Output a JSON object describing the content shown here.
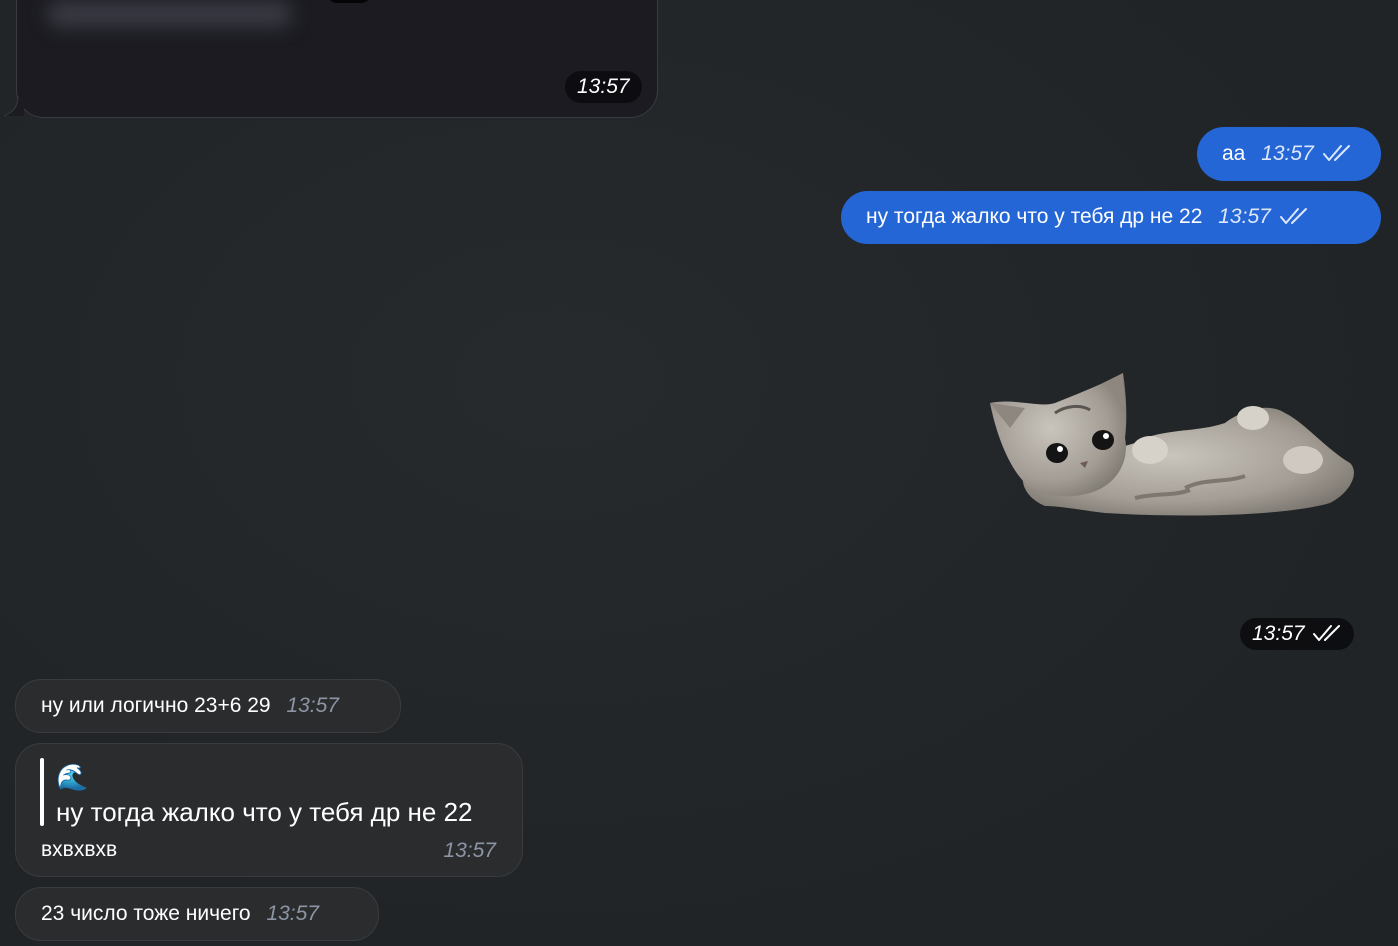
{
  "colors": {
    "background": "#212527",
    "incoming_bubble": "#2b2c2e",
    "outgoing_bubble": "#2566d6"
  },
  "messages": {
    "media_time": "13:57",
    "out_1": {
      "text": "аа",
      "time": "13:57",
      "status_icon": "double-check-icon"
    },
    "out_2": {
      "text": "ну тогда жалко что у тебя др не 22",
      "time": "13:57",
      "status_icon": "double-check-icon"
    },
    "sticker": {
      "icon": "kitten-sticker",
      "time": "13:57",
      "status_icon": "double-check-icon"
    },
    "in_1": {
      "text": "ну или логично 23+6 29",
      "time": "13:57"
    },
    "in_2": {
      "quote_emoji": "🌊",
      "quote_text": "ну тогда жалко что у тебя др не 22",
      "text": "вхвхвхв",
      "time": "13:57"
    },
    "in_3": {
      "text": "23 число тоже ничего",
      "time": "13:57"
    }
  }
}
